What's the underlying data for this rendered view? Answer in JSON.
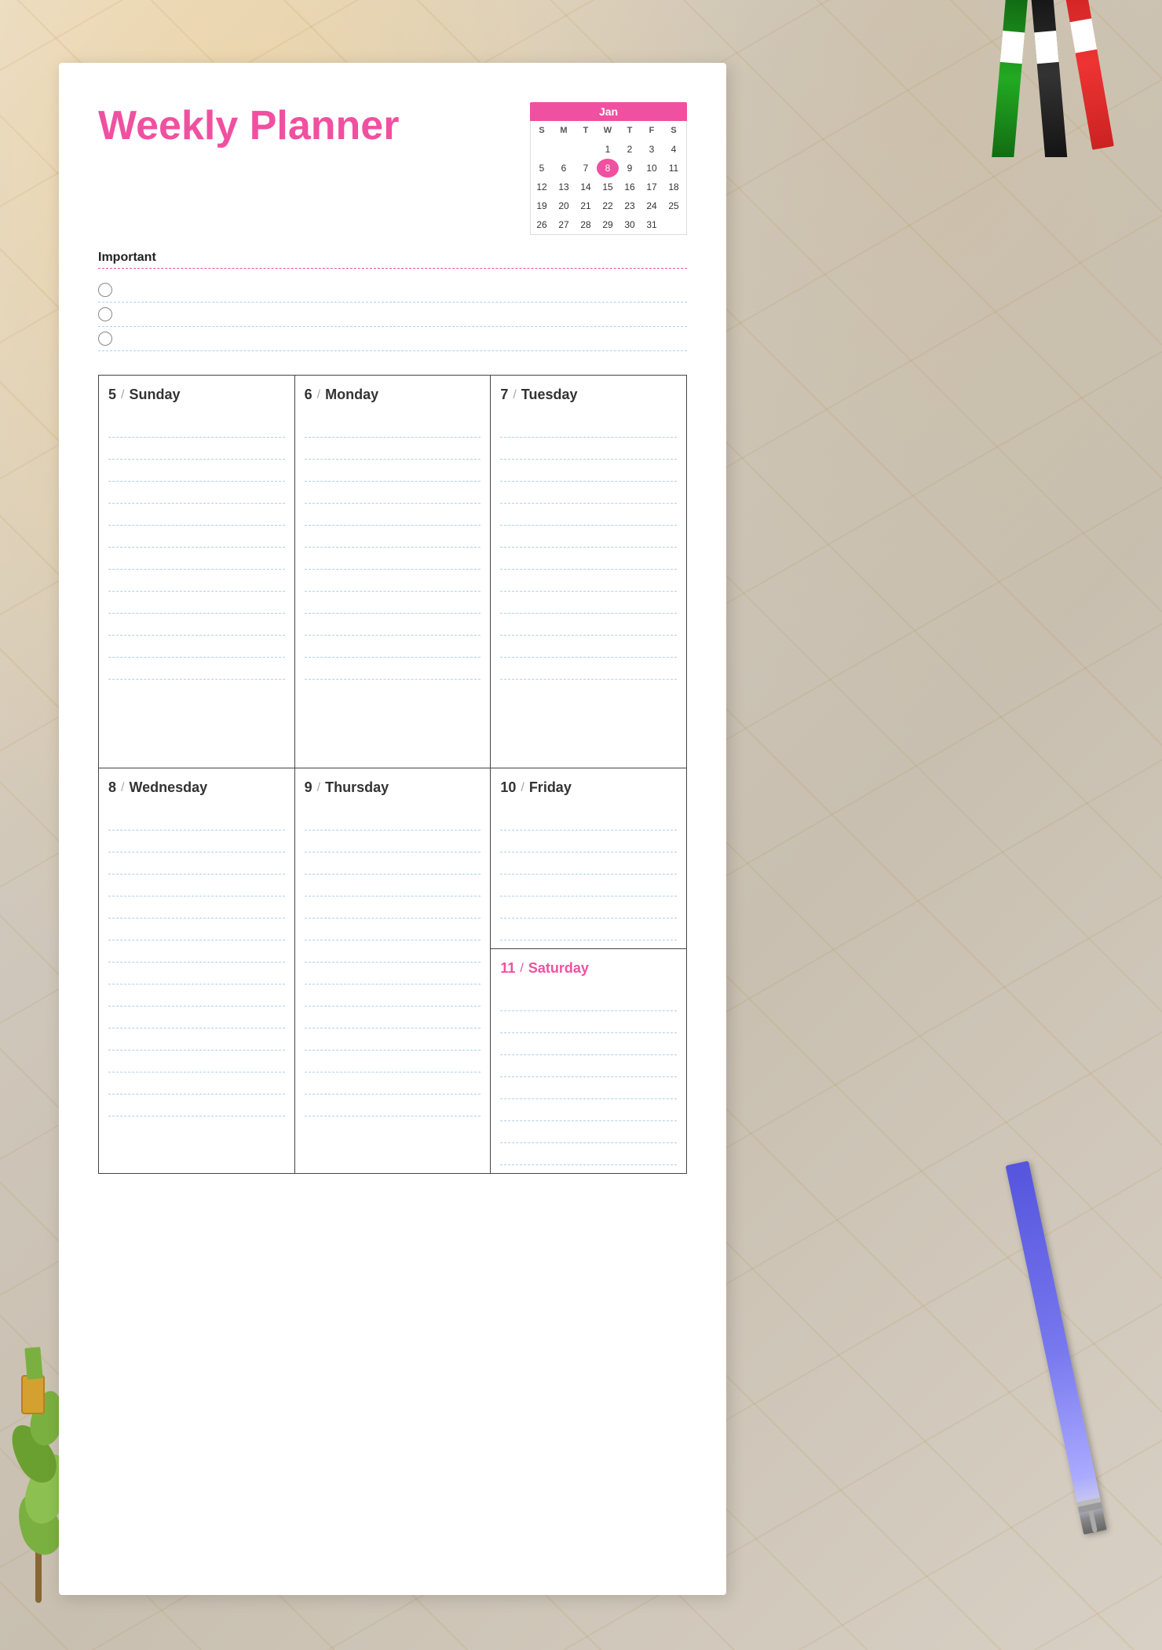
{
  "title": "Weekly Planner",
  "calendar": {
    "month": "Jan",
    "headers": [
      "S",
      "M",
      "T",
      "W",
      "T",
      "F",
      "S"
    ],
    "weeks": [
      [
        "",
        "",
        "",
        "1",
        "2",
        "3",
        "4"
      ],
      [
        "5",
        "6",
        "7",
        "8",
        "9",
        "10",
        "11"
      ],
      [
        "12",
        "13",
        "14",
        "15",
        "16",
        "17",
        "18"
      ],
      [
        "19",
        "20",
        "21",
        "22",
        "23",
        "24",
        "25"
      ],
      [
        "26",
        "27",
        "28",
        "29",
        "30",
        "31",
        ""
      ]
    ],
    "highlight": "8"
  },
  "important": {
    "label": "Important",
    "items": [
      "",
      "",
      ""
    ]
  },
  "days_top": [
    {
      "number": "5",
      "name": "Sunday",
      "lines": 12
    },
    {
      "number": "6",
      "name": "Monday",
      "lines": 12
    },
    {
      "number": "7",
      "name": "Tuesday",
      "lines": 12
    }
  ],
  "days_bottom": [
    {
      "number": "8",
      "name": "Wednesday",
      "lines": 14,
      "saturday": false
    },
    {
      "number": "9",
      "name": "Thursday",
      "lines": 14,
      "saturday": false
    },
    {
      "number": "10",
      "name": "Friday",
      "lines": 6,
      "saturday": false
    },
    {
      "number": "11",
      "name": "Saturday",
      "lines": 8,
      "saturday": true
    }
  ]
}
